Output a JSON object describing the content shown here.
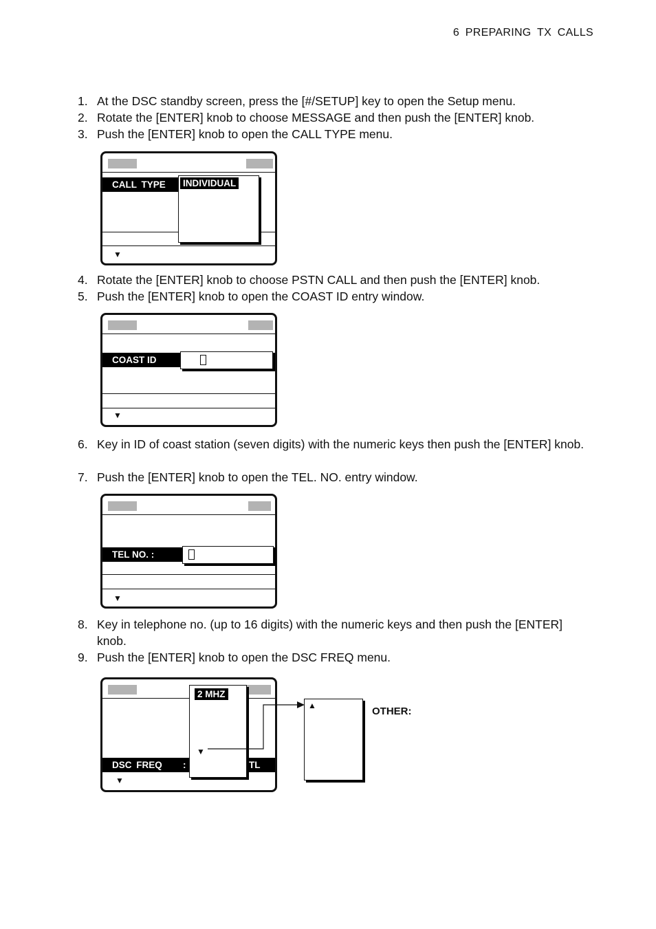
{
  "header": {
    "title": "6   PREPARING  TX  CALLS"
  },
  "steps": [
    {
      "num": "1.",
      "text": "At the DSC standby screen, press the [#/SETUP] key to open the Setup menu."
    },
    {
      "num": "2.",
      "text": "Rotate the [ENTER] knob to choose MESSAGE and then push the [ENTER] knob."
    },
    {
      "num": "3.",
      "text": "Push the [ENTER] knob to open the CALL TYPE menu."
    },
    {
      "num": "4.",
      "text": "Rotate the [ENTER] knob to choose PSTN CALL and then push the [ENTER] knob."
    },
    {
      "num": "5.",
      "text": "Push the [ENTER] knob to open the COAST ID entry window."
    },
    {
      "num": "6.",
      "text": "Key in ID of coast station (seven digits) with the numeric keys then push the [ENTER] knob."
    },
    {
      "num": "7.",
      "text": "Push the [ENTER] knob to open the TEL. NO. entry window."
    },
    {
      "num": "8.",
      "text": "Key in telephone no. (up to 16 digits) with the numeric keys and then push the  [ENTER] knob."
    },
    {
      "num": "9.",
      "text": "Push the [ENTER] knob to open the DSC FREQ menu."
    }
  ],
  "figures": {
    "call_type": {
      "label": "CALL  TYPE",
      "selected": "INDIVIDUAL",
      "down_arrow": "▼"
    },
    "coast_id": {
      "label": "COAST ID",
      "value": "",
      "down_arrow": "▼"
    },
    "tel_no": {
      "label": "TEL NO. :",
      "value": "",
      "down_arrow": "▼"
    },
    "dsc_freq": {
      "label": "DSC  FREQ",
      "colon": ":",
      "suffix": "TL",
      "selected": "2 MHZ",
      "more_arrow": "▼",
      "down_arrow": "▼",
      "other_up_arrow": "▲",
      "other_label": "OTHER:"
    }
  }
}
